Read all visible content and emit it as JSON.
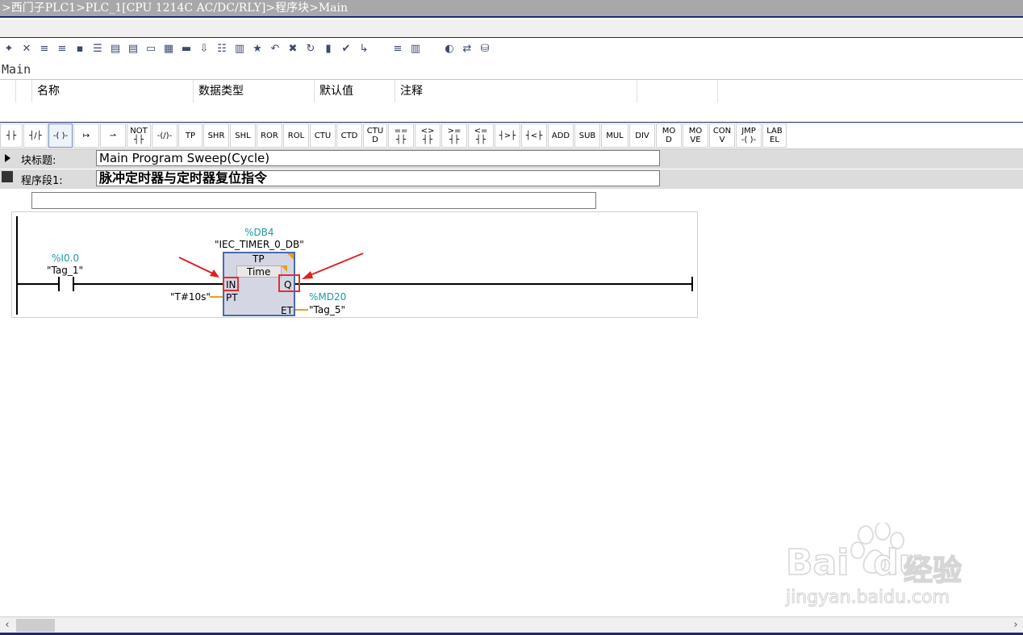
{
  "breadcrumb": ">西门子PLC1>PLC_1[CPU 1214C AC/DC/RLY]>程序块>Main",
  "block_name": "Main",
  "interface": {
    "columns": [
      "名称",
      "数据类型",
      "默认值",
      "注释"
    ]
  },
  "toolbar_icons": [
    "add-network-icon",
    "delete-network-icon",
    "insert-row-icon",
    "add-row-icon",
    "remove-row-icon",
    "list-icon",
    "expand-icon",
    "collapse-icon",
    "comment-icon",
    "monitor-icon",
    "load-icon",
    "compare-icon",
    "download-icon",
    "columns-icon",
    "favorite-icon",
    "undo-icon",
    "delete-icon",
    "refresh-icon",
    "counter-icon",
    "check-icon",
    "jump-icon",
    "indent-icon",
    "bookmark-icon",
    "simulate-icon",
    "network-view-icon",
    "database-icon"
  ],
  "instructions": [
    {
      "l1": "┤├",
      "l2": ""
    },
    {
      "l1": "┤/├",
      "l2": ""
    },
    {
      "l1": "-( )-",
      "l2": "",
      "selected": true
    },
    {
      "l1": "↦",
      "l2": ""
    },
    {
      "l1": "⇀",
      "l2": ""
    },
    {
      "l1": "NOT",
      "l2": "┤├"
    },
    {
      "l1": "-(/)-",
      "l2": ""
    },
    {
      "l1": "TP",
      "l2": ""
    },
    {
      "l1": "SHR",
      "l2": ""
    },
    {
      "l1": "SHL",
      "l2": ""
    },
    {
      "l1": "ROR",
      "l2": ""
    },
    {
      "l1": "ROL",
      "l2": ""
    },
    {
      "l1": "CTU",
      "l2": ""
    },
    {
      "l1": "CTD",
      "l2": ""
    },
    {
      "l1": "CTU",
      "l2": "D"
    },
    {
      "l1": "==",
      "l2": "┤├"
    },
    {
      "l1": "<>",
      "l2": "┤├"
    },
    {
      "l1": ">=",
      "l2": "┤├"
    },
    {
      "l1": "<=",
      "l2": "┤├"
    },
    {
      "l1": "┤>├",
      "l2": ""
    },
    {
      "l1": "┤<├",
      "l2": ""
    },
    {
      "l1": "ADD",
      "l2": ""
    },
    {
      "l1": "SUB",
      "l2": ""
    },
    {
      "l1": "MUL",
      "l2": ""
    },
    {
      "l1": "DIV",
      "l2": ""
    },
    {
      "l1": "MO",
      "l2": "D"
    },
    {
      "l1": "MO",
      "l2": "VE"
    },
    {
      "l1": "CON",
      "l2": "V"
    },
    {
      "l1": "JMP",
      "l2": "-( )-"
    },
    {
      "l1": "LAB",
      "l2": "EL"
    }
  ],
  "block_title": {
    "label": "块标题:",
    "value": "Main Program Sweep(Cycle)"
  },
  "network1": {
    "label": "程序段1:",
    "value": "脉冲定时器与定时器复位指令"
  },
  "ladder": {
    "contact_addr": "%I0.0",
    "contact_tag": "\"Tag_1\"",
    "db_addr": "%DB4",
    "db_name": "\"IEC_TIMER_0_DB\"",
    "fb_type": "TP",
    "fb_subtype": "Time",
    "pin_in": "IN",
    "pin_q": "Q",
    "pin_pt": "PT",
    "pin_et": "ET",
    "pt_value": "\"T#10s\"",
    "et_addr": "%MD20",
    "et_tag": "\"Tag_5\""
  },
  "watermark": {
    "brand": "Bai",
    "brand2": "du",
    "cn": "经验",
    "url": "jingyan.baidu.com"
  },
  "colors": {
    "teal": "#1c9aa0",
    "fb_fill": "#d4d6e4",
    "fb_border": "#4a6aa8",
    "highlight": "#e03030",
    "accent_line": "#1c2a6e"
  }
}
